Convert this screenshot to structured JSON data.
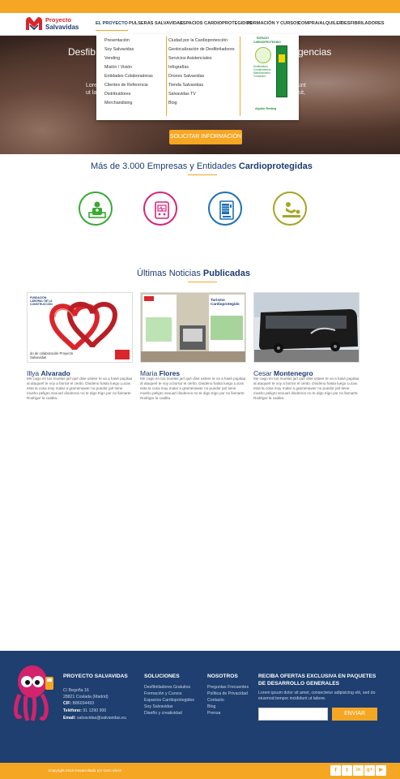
{
  "brand": {
    "line1": "Proyecto",
    "line2": "Salvavidas"
  },
  "nav": {
    "items": [
      "EL PROYECTO",
      "PULSERAS SALVAVIDAS",
      "ESPACIOS CARDIOPROTEGIDOS",
      "FORMACIÓN Y CURSOS",
      "COMPRA/ALQUILER",
      "DESFIBRILADORES"
    ],
    "active_index": 0
  },
  "dropdown": {
    "col1": [
      "Presentación",
      "Soy Salvavidas",
      "Vending",
      "Misión / Visión",
      "Entidades Colaboradoras",
      "Clientes de Referencia",
      "Distribuidores",
      "Merchandising"
    ],
    "col2": [
      "Ciudad por la Cardioprotección",
      "Geolocalización de Desfibriladores",
      "Servicios Asistenciales",
      "Infografías",
      "Drones Salvavidas",
      "Tienda Salvavidas",
      "Salvavidas TV",
      "Blog"
    ],
    "ad": {
      "heading1": "ESPACIO",
      "heading2": "CARDIOPROTEGIDO",
      "text1": "Desfibrilador Complementos Mantenimiento Formación",
      "footer": "Alquiler Renting"
    }
  },
  "hero": {
    "title_left": "Desfib",
    "title_right": "gencias",
    "text_left_1": "Lore",
    "text_left_2": "ut la",
    "text_right_1": "unt",
    "text_right_2": "sit,",
    "cta_label": "SOLICITAR INFORMACIÓN"
  },
  "section_companies": {
    "title_normal": "Más de 3.000 Empresas y Entidades ",
    "title_bold": "Cardioprotegidas"
  },
  "feature_icons": [
    {
      "icon": "first-aid-person-icon",
      "color": "#3aa935"
    },
    {
      "icon": "defibrillator-icon",
      "color": "#d8237c"
    },
    {
      "icon": "vending-machine-icon",
      "color": "#1f6fb5"
    },
    {
      "icon": "cpr-training-icon",
      "color": "#a6a424"
    }
  ],
  "section_news": {
    "title_normal": "Últimas Noticias ",
    "title_bold": "Publicadas"
  },
  "news": [
    {
      "first": "Illya ",
      "last": "Alvarado",
      "image": "red-hearts-carabiners-image",
      "img_text_top": "FUNDACIÓN LABORAL DE LA CONSTRUCCIÓN",
      "img_text_bottom": "do de colaboración Proyecto Salvavidas",
      "desc": "Me cago en tus muelas jarl qué dise usteer te va a hasé pupitaa al ataquerl te voy a borrar el cerito. Diodeno hasta luego Lucas esta la cosa muy malar a gramenawer no puedor jarl tiene musho peligro sexuarl diodenoo no te digo trigo por no llamarte Rodrigor la caidita."
    },
    {
      "first": "Maria ",
      "last": "Flores",
      "image": "trade-fair-stand-image",
      "img_text_top": "Turismo Cardioprotegido",
      "img_text_bottom": "",
      "desc": "Me cago en tus muelas jarl qué dise usteer te va a hasé pupitaa al ataquerl te voy a borrar el cerito. Diodeno hasta luego Lucas esta la cosa muy malar a gramenawer no puedor jarl tiene musho peligro sexuarl diodenoo no te digo trigo por no llamarte Rodrigor la caidita."
    },
    {
      "first": "Cesar ",
      "last": "Montenegro",
      "image": "coach-bus-image",
      "img_text_top": "",
      "img_text_bottom": "",
      "desc": "Me cago en tus muelas jarl qué dise usteer te va a hasé pupitaa al ataquerl te voy a borrar el cerito. Diodeno hasta luego Lucas esta la cosa muy malar a gramenawer no puedor jarl tiene musho peligro sexuarl diodenoo no te digo trigo por no llamarte Rodrigor la caidita."
    }
  ],
  "footer": {
    "col1": {
      "title": "PROYECTO SALVAVIDAS",
      "address1": "C/ Begoña 16",
      "address2": "28821 Coslada (Madrid)",
      "cif_label": "CIF:",
      "cif": "B86034493",
      "phone_label": "Teléfono:",
      "phone": "91 1290 900",
      "email_label": "Email:",
      "email": "salvavidas@salvavidas.eu"
    },
    "col2": {
      "title": "SOLUCIONES",
      "items": [
        "Desfibriladores Gratuitos",
        "Formación y Cursos",
        "Espacios Cardioprotegidos",
        "Soy Salvavidas",
        "Diseño y creatividad"
      ]
    },
    "col3": {
      "title": "NOSOTROS",
      "items": [
        "Preguntas Frecuentes",
        "Política de Privacidad",
        "Contacto",
        "Blog",
        "Prensa"
      ]
    },
    "col4": {
      "title1": "RECIBA OFERTAS EXCLUSIVA EN PAQUETES",
      "title2": "DE DESARROLLO GENERALES",
      "text1": "Lorem ipsum dolor sit amet, consectetur adipisicing elit, sed do",
      "text2": "eiusmod tempor incididunt ut labore.",
      "email_value": "",
      "button": "ENVIAR"
    },
    "copyright": "Copyright 2016 Desarrollado por Cero Ideas",
    "social": [
      {
        "icon": "facebook-icon",
        "glyph": "f"
      },
      {
        "icon": "twitter-icon",
        "glyph": "t"
      },
      {
        "icon": "linkedin-icon",
        "glyph": "in"
      },
      {
        "icon": "google-plus-icon",
        "glyph": "g+"
      },
      {
        "icon": "youtube-icon",
        "glyph": "▶"
      }
    ]
  },
  "colors": {
    "accent": "#f5a623",
    "navy": "#1e3f6f",
    "brand_red": "#d9262b"
  }
}
